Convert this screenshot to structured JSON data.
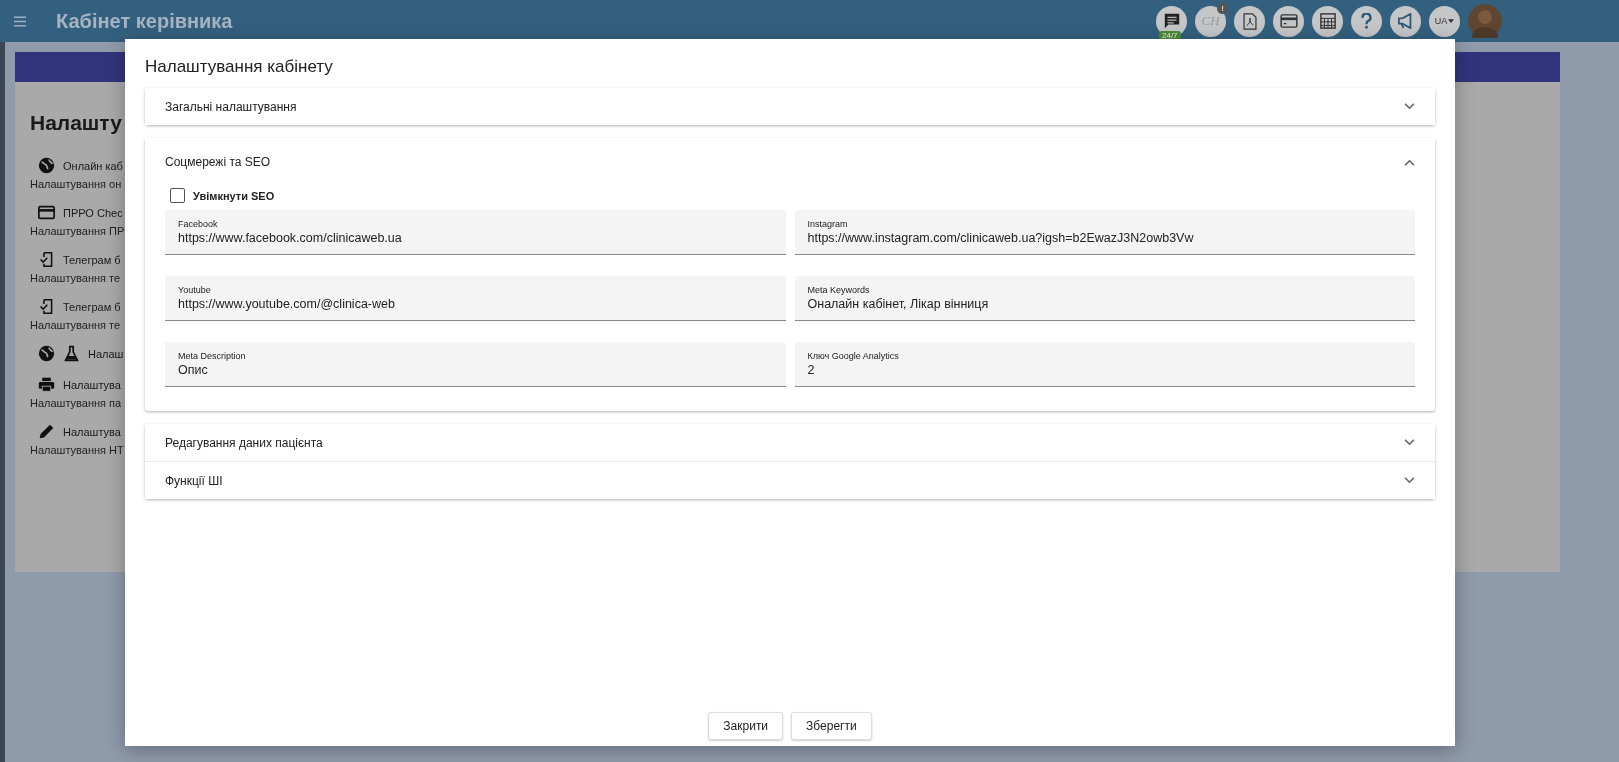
{
  "topbar": {
    "title": "Кабінет керівника",
    "icons": [
      {
        "kind": "chat",
        "badge": "24/7"
      },
      {
        "kind": "signature",
        "text": "CH",
        "alert": "!"
      },
      {
        "kind": "pdf"
      },
      {
        "kind": "card"
      },
      {
        "kind": "calculator"
      },
      {
        "kind": "help"
      },
      {
        "kind": "megaphone"
      },
      {
        "kind": "language",
        "text": "UA"
      },
      {
        "kind": "avatar"
      }
    ]
  },
  "background": {
    "heading": "Налашту",
    "items": [
      {
        "icons": [
          {
            "kind": "globe"
          }
        ],
        "title": "Онлайн каб",
        "subtitle": "Налаштування он"
      },
      {
        "icons": [
          {
            "kind": "card"
          }
        ],
        "title": "ПРРО Chec",
        "subtitle": "Налаштування ПР"
      },
      {
        "icons": [
          {
            "kind": "phone-check"
          }
        ],
        "title": "Телеграм б",
        "subtitle": "Налаштування те"
      },
      {
        "icons": [
          {
            "kind": "phone-check"
          }
        ],
        "title": "Телеграм б",
        "subtitle": "Налаштування те"
      },
      {
        "icons": [
          {
            "kind": "globe"
          },
          {
            "kind": "flask"
          }
        ],
        "title": "Налаш"
      },
      {
        "icons": [
          {
            "kind": "printer"
          }
        ],
        "title": "Налаштува",
        "subtitle": "Налаштування па"
      },
      {
        "icons": [
          {
            "kind": "pencil"
          }
        ],
        "title": "Налаштува",
        "subtitle": "Налаштування НТ"
      }
    ]
  },
  "dialog": {
    "title": "Налаштування кабінету",
    "panels": [
      {
        "title": "Загальні налаштування",
        "expanded": false
      },
      {
        "title": "Соцмережі та SEO",
        "expanded": true,
        "checkbox": {
          "label": "Увімкнути SEO",
          "checked": false
        },
        "fields": [
          {
            "label": "Facebook",
            "value": "https://www.facebook.com/clinicaweb.ua"
          },
          {
            "label": "Instagram",
            "value": "https://www.instagram.com/clinicaweb.ua?igsh=b2EwazJ3N2owb3Vw"
          },
          {
            "label": "Youtube",
            "value": "https://www.youtube.com/@clinica-web"
          },
          {
            "label": "Meta Keywords",
            "value": "Оналайн кабінет, Лікар вінниця"
          },
          {
            "label": "Meta Description",
            "value": "Опис"
          },
          {
            "label": "Ключ Google Analytics",
            "value": "2"
          }
        ]
      },
      {
        "title": "Редагування даних пацієнта",
        "expanded": false
      },
      {
        "title": "Функції ШІ",
        "expanded": false
      }
    ],
    "buttons": [
      "Закрити",
      "Зберегти"
    ]
  }
}
